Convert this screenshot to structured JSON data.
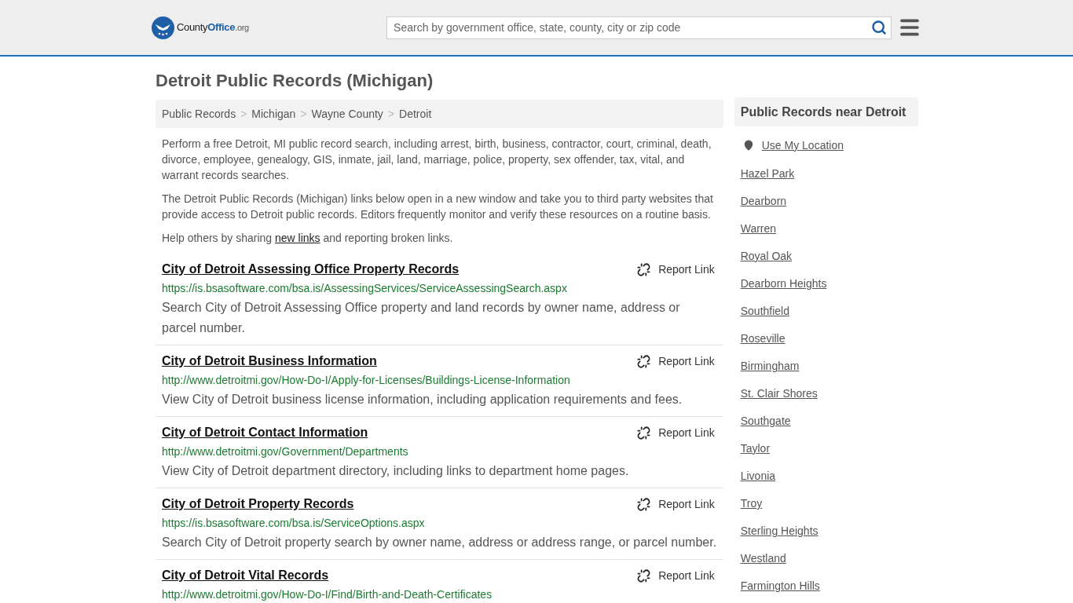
{
  "header": {
    "logo": {
      "name": "County",
      "highlight": "Office",
      "suffix": ".org"
    },
    "search": {
      "placeholder": "Search by government office, state, county, city or zip code"
    }
  },
  "title": "Detroit Public Records (Michigan)",
  "breadcrumb": [
    "Public Records",
    "Michigan",
    "Wayne County",
    "Detroit"
  ],
  "breadcrumb_separator": ">",
  "intro": [
    "Perform a free Detroit, MI public record search, including arrest, birth, business, contractor, court, criminal, death, divorce, employee, genealogy, GIS, inmate, jail, land, marriage, police, property, sex offender, tax, vital, and warrant records searches.",
    "The Detroit Public Records (Michigan) links below open in a new window and take you to third party websites that provide access to Detroit public records. Editors frequently monitor and verify these resources on a routine basis."
  ],
  "help": {
    "before": "Help others by sharing",
    "link": "new links",
    "after": "and reporting broken links."
  },
  "records": [
    {
      "title": "City of Detroit Assessing Office Property Records",
      "url": "https://is.bsasoftware.com/bsa.is/AssessingServices/ServiceAssessingSearch.aspx",
      "description": "Search City of Detroit Assessing Office property and land records by owner name, address or parcel number.",
      "report": "Report Link"
    },
    {
      "title": "City of Detroit Business Information",
      "url": "http://www.detroitmi.gov/How-Do-I/Apply-for-Licenses/Buildings-License-Information",
      "description": "View City of Detroit business license information, including application requirements and fees.",
      "report": "Report Link"
    },
    {
      "title": "City of Detroit Contact Information",
      "url": "http://www.detroitmi.gov/Government/Departments",
      "description": "View City of Detroit department directory, including links to department home pages.",
      "report": "Report Link"
    },
    {
      "title": "City of Detroit Property Records",
      "url": "https://is.bsasoftware.com/bsa.is/ServiceOptions.aspx",
      "description": "Search City of Detroit property search by owner name, address or address range, or parcel number.",
      "report": "Report Link"
    },
    {
      "title": "City of Detroit Vital Records",
      "url": "http://www.detroitmi.gov/How-Do-I/Find/Birth-and-Death-Certificates",
      "report": "Report Link"
    }
  ],
  "sidebar": {
    "title": "Public Records near Detroit",
    "location": "Use My Location",
    "places": [
      "Hazel Park",
      "Dearborn",
      "Warren",
      "Royal Oak",
      "Dearborn Heights",
      "Southfield",
      "Roseville",
      "Birmingham",
      "St. Clair Shores",
      "Southgate",
      "Taylor",
      "Livonia",
      "Troy",
      "Sterling Heights",
      "Westland",
      "Farmington Hills"
    ]
  }
}
